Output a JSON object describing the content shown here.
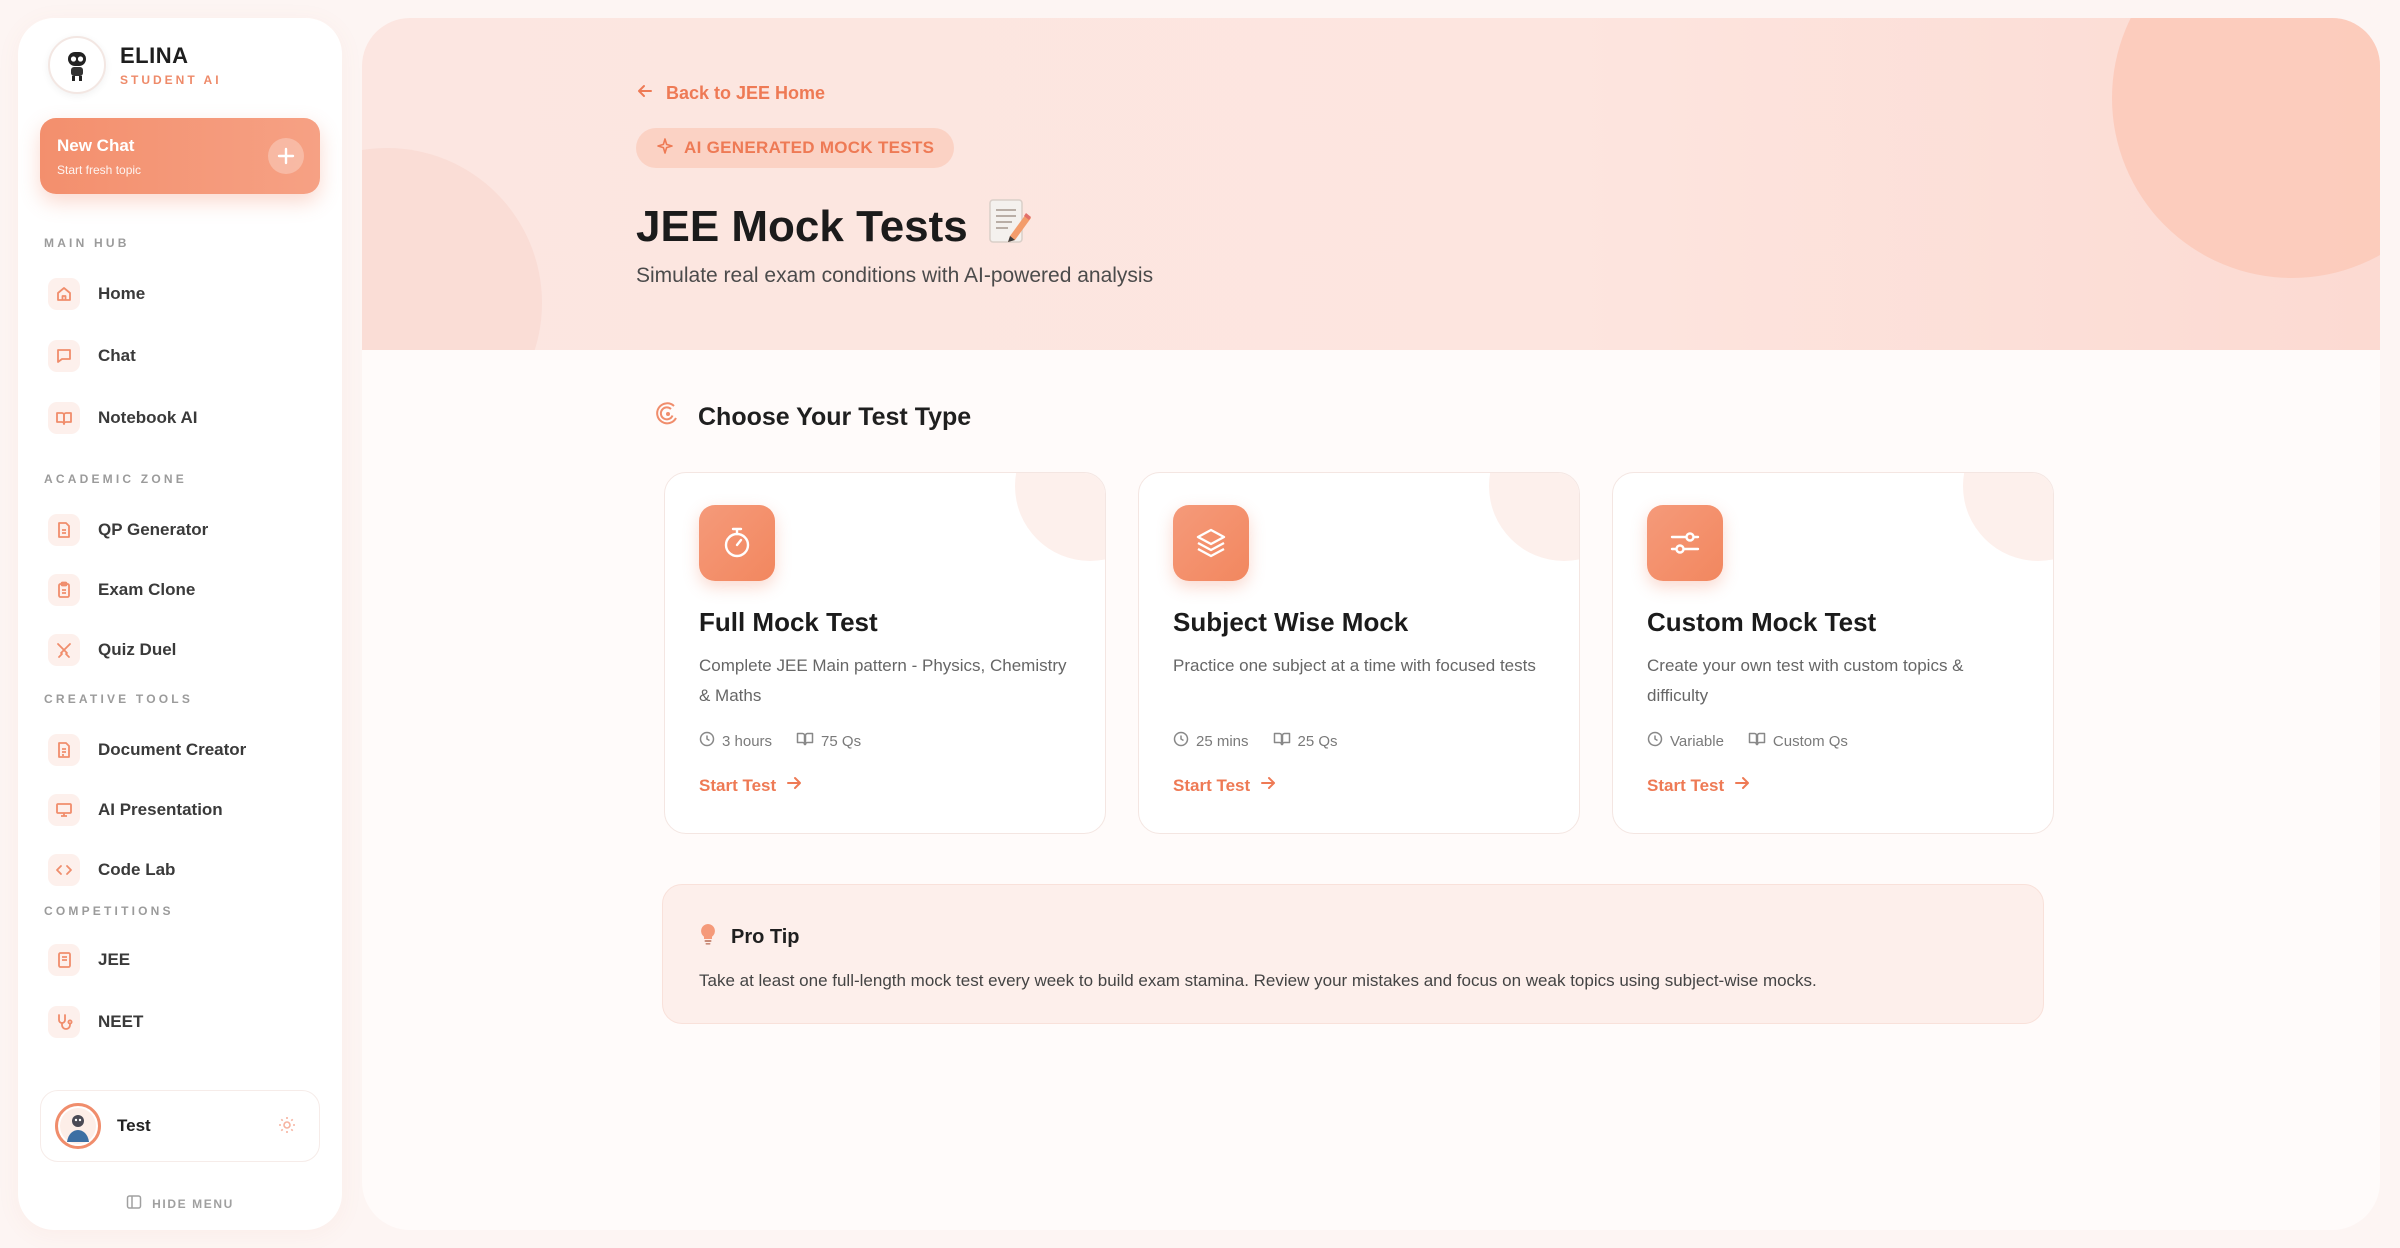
{
  "brand": {
    "name": "ELINA",
    "subtitle": "STUDENT AI"
  },
  "new_chat": {
    "title": "New Chat",
    "subtitle": "Start fresh topic"
  },
  "sidebar": {
    "sections": {
      "main_hub": "MAIN HUB",
      "academic_zone": "ACADEMIC ZONE",
      "creative_tools": "CREATIVE TOOLS",
      "competitions": "COMPETITIONS"
    },
    "items": {
      "home": "Home",
      "chat": "Chat",
      "notebook": "Notebook AI",
      "qp_generator": "QP Generator",
      "exam_clone": "Exam Clone",
      "quiz_duel": "Quiz Duel",
      "document_creator": "Document Creator",
      "ai_presentation": "AI Presentation",
      "code_lab": "Code Lab",
      "jee": "JEE",
      "neet": "NEET"
    },
    "user": {
      "name": "Test"
    },
    "hide_menu": "HIDE MENU"
  },
  "hero": {
    "back_link": "Back to JEE Home",
    "badge": "AI GENERATED MOCK TESTS",
    "title": "JEE Mock Tests",
    "subtitle": "Simulate real exam conditions with AI-powered analysis"
  },
  "section_title": "Choose Your Test Type",
  "cards": [
    {
      "title": "Full Mock Test",
      "description": "Complete JEE Main pattern - Physics, Chemistry & Maths",
      "duration": "3 hours",
      "questions": "75 Qs",
      "cta": "Start Test",
      "icon": "stopwatch-icon"
    },
    {
      "title": "Subject Wise Mock",
      "description": "Practice one subject at a time with focused tests",
      "duration": "25 mins",
      "questions": "25 Qs",
      "cta": "Start Test",
      "icon": "layers-icon"
    },
    {
      "title": "Custom Mock Test",
      "description": "Create your own test with custom topics & difficulty",
      "duration": "Variable",
      "questions": "Custom Qs",
      "cta": "Start Test",
      "icon": "sliders-icon"
    }
  ],
  "pro_tip": {
    "title": "Pro Tip",
    "text": "Take at least one full-length mock test every week to build exam stamina. Review your mistakes and focus on weak topics using subject-wise mocks."
  },
  "colors": {
    "accent": "#ee7a55",
    "accent_light": "#fdf0ec",
    "hero_bg": "#fce6e1"
  }
}
